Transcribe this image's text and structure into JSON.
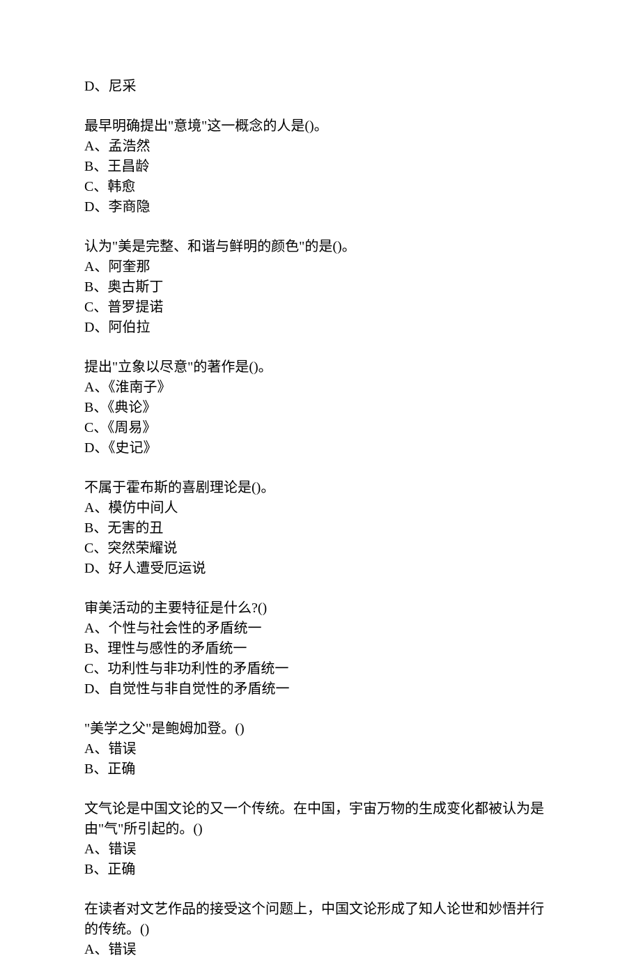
{
  "orphan_option": "D、尼采",
  "questions": [
    {
      "stem": "最早明确提出\"意境\"这一概念的人是()。",
      "options": [
        "A、孟浩然",
        "B、王昌龄",
        "C、韩愈",
        "D、李商隐"
      ]
    },
    {
      "stem": "认为\"美是完整、和谐与鲜明的颜色\"的是()。",
      "options": [
        "A、阿奎那",
        "B、奥古斯丁",
        "C、普罗提诺",
        "D、阿伯拉"
      ]
    },
    {
      "stem": "提出\"立象以尽意\"的著作是()。",
      "options": [
        "A、《淮南子》",
        "B、《典论》",
        "C、《周易》",
        "D、《史记》"
      ]
    },
    {
      "stem": "不属于霍布斯的喜剧理论是()。",
      "options": [
        "A、模仿中间人",
        "B、无害的丑",
        "C、突然荣耀说",
        "D、好人遭受厄运说"
      ]
    },
    {
      "stem": "审美活动的主要特征是什么?()",
      "options": [
        "A、个性与社会性的矛盾统一",
        "B、理性与感性的矛盾统一",
        "C、功利性与非功利性的矛盾统一",
        "D、自觉性与非自觉性的矛盾统一"
      ]
    },
    {
      "stem": "\"美学之父\"是鲍姆加登。()",
      "options": [
        "A、错误",
        "B、正确"
      ]
    },
    {
      "stem": "文气论是中国文论的又一个传统。在中国，宇宙万物的生成变化都被认为是由\"气\"所引起的。()",
      "options": [
        "A、错误",
        "B、正确"
      ]
    },
    {
      "stem": "在读者对文艺作品的接受这个问题上，中国文论形成了知人论世和妙悟并行的传统。()",
      "options": [
        "A、错误"
      ]
    }
  ]
}
